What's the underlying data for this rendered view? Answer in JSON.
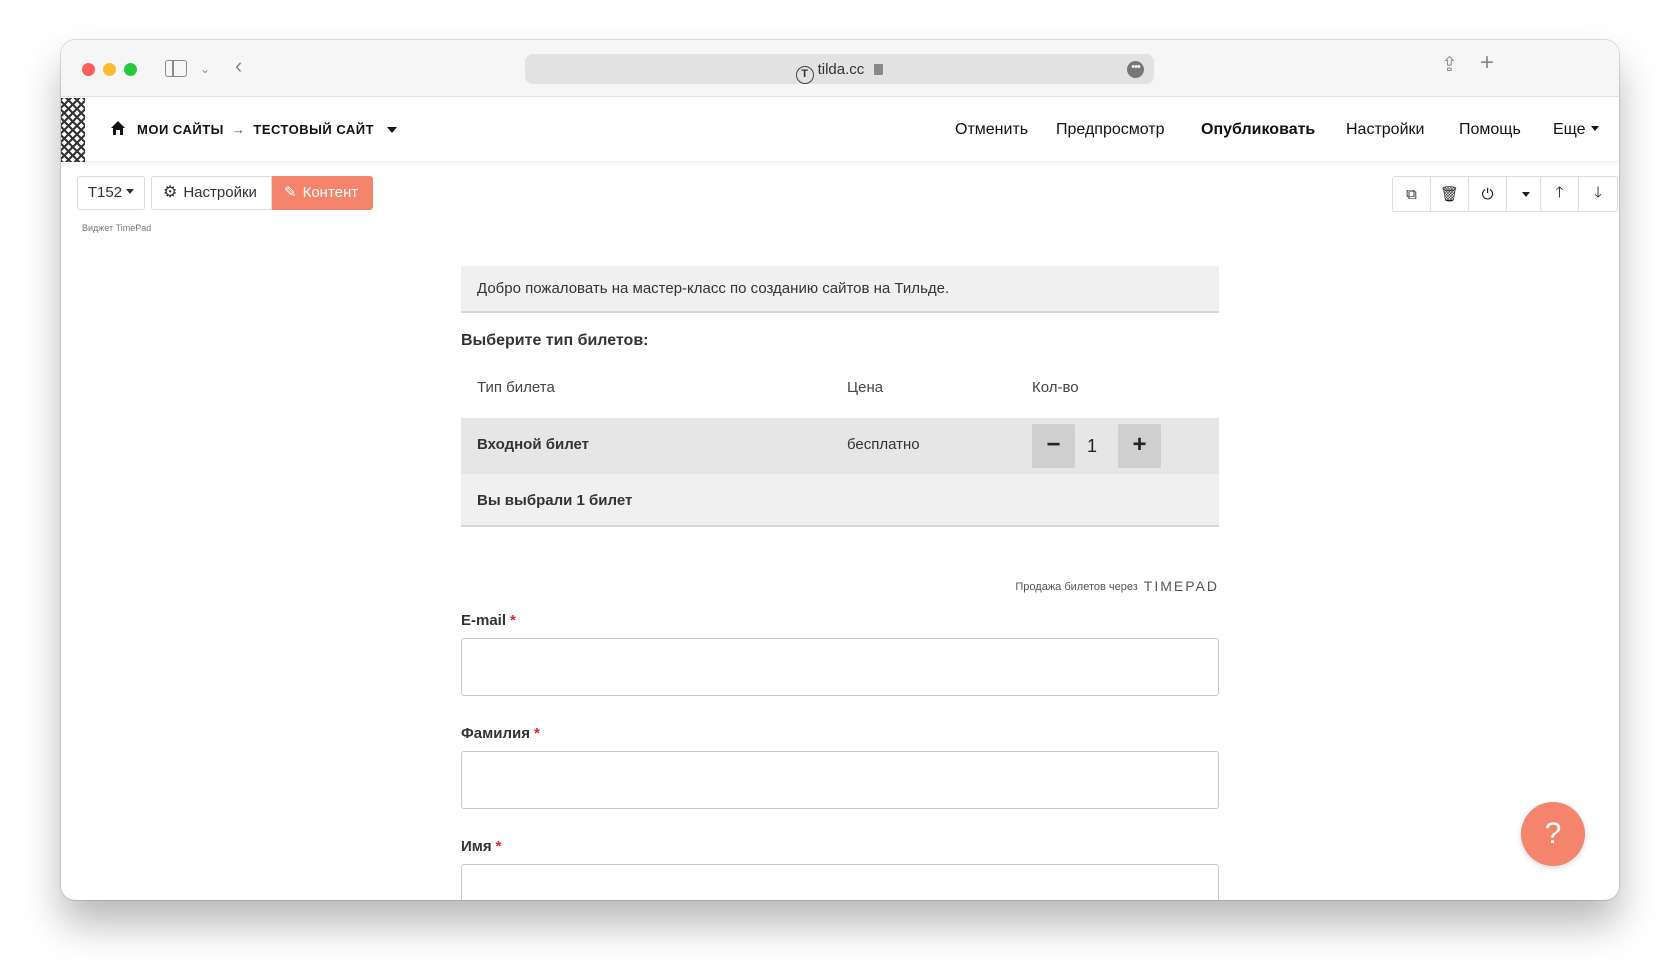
{
  "browser": {
    "url": "tilda.cc"
  },
  "topbar": {
    "breadcrumb_my_sites": "МОИ САЙТЫ",
    "breadcrumb_arrow": "→",
    "breadcrumb_site": "ТЕСТОВЫЙ САЙТ",
    "nav": {
      "cancel": "Отменить",
      "preview": "Предпросмотр",
      "publish": "Опубликовать",
      "settings": "Настройки",
      "help": "Помощь",
      "more": "Еще"
    }
  },
  "block_toolbar": {
    "block_id": "T152",
    "settings_label": "Настройки",
    "content_label": "Контент",
    "widget_label": "Виджет TimePad"
  },
  "widget": {
    "welcome_text": "Добро пожаловать на мастер-класс по созданию сайтов на Тильде.",
    "choose_title": "Выберите тип билетов:",
    "columns": [
      "Тип билета",
      "Цена",
      "Кол-во"
    ],
    "tickets": [
      {
        "name": "Входной билет",
        "price": "бесплатно",
        "quantity": "1"
      }
    ],
    "summary": "Вы выбрали 1 билет",
    "powered_by": "Продажа билетов через",
    "powered_brand": "TIMEPAD",
    "fields": [
      {
        "label": "E-mail",
        "required_mark": "*",
        "value": ""
      },
      {
        "label": "Фамилия",
        "required_mark": "*",
        "value": ""
      },
      {
        "label": "Имя",
        "required_mark": "*",
        "value": ""
      }
    ]
  },
  "help_button": "?",
  "colors": {
    "accent": "#f4846b",
    "close": "#fe5f57",
    "minimize": "#febc2e",
    "maximize": "#28c840"
  }
}
